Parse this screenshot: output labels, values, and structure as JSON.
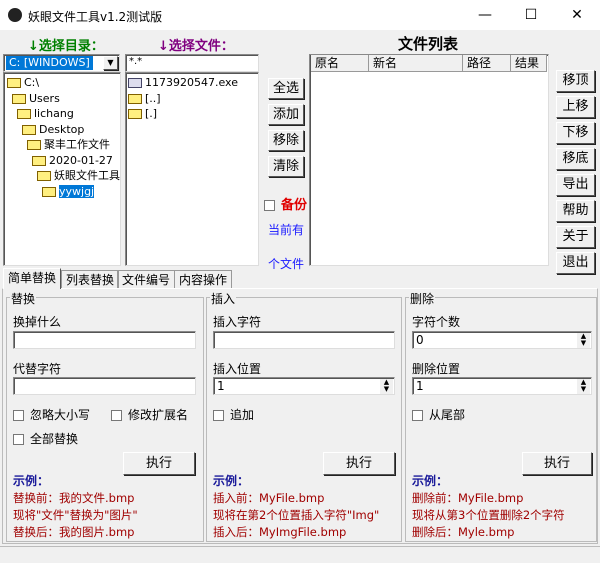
{
  "window": {
    "title": "妖眼文件工具v1.2测试版",
    "minimize": "—",
    "maximize": "☐",
    "close": "✕"
  },
  "left": {
    "dir_label": "↓选择目录：",
    "file_label": "↓选择文件：",
    "drive": "C: [WINDOWS]",
    "filter": "*.*",
    "tree": [
      {
        "label": "C:\\",
        "level": 0
      },
      {
        "label": "Users",
        "level": 1
      },
      {
        "label": "lichang",
        "level": 2
      },
      {
        "label": "Desktop",
        "level": 3
      },
      {
        "label": "聚丰工作文件",
        "level": 4
      },
      {
        "label": "2020-01-27",
        "level": 5
      },
      {
        "label": "妖眼文件工具",
        "level": 6
      },
      {
        "label": "yywjgj",
        "level": 7,
        "selected": true
      }
    ],
    "files": [
      {
        "label": "1173920547.exe",
        "icon": "exe-icon"
      },
      {
        "label": "[..]",
        "icon": "folder-icon"
      },
      {
        "label": "[.]",
        "icon": "folder-icon"
      }
    ]
  },
  "mid": {
    "buttons": [
      "全选",
      "添加",
      "移除",
      "清除"
    ],
    "backup": "备份",
    "current": "当前有",
    "count_suffix": "个文件"
  },
  "list": {
    "title": "文件列表",
    "columns": [
      "原名",
      "新名",
      "路径",
      "结果"
    ]
  },
  "right_buttons": [
    "移顶",
    "上移",
    "下移",
    "移底",
    "导出",
    "帮助",
    "关于",
    "退出"
  ],
  "tabs": [
    "简单替换",
    "列表替换",
    "文件编号",
    "内容操作"
  ],
  "replace": {
    "title": "替换",
    "find_label": "换掉什么",
    "find_value": "",
    "replace_label": "代替字符",
    "replace_value": "",
    "ignore_case": "忽略大小写",
    "modify_ext": "修改扩展名",
    "replace_all": "全部替换",
    "run": "执行",
    "example": "示例：",
    "ex1": "替换前：我的文件.bmp",
    "ex2": "现将\"文件\"替换为\"图片\"",
    "ex3": "替换后：我的图片.bmp"
  },
  "insert": {
    "title": "插入",
    "char_label": "插入字符",
    "char_value": "",
    "pos_label": "插入位置",
    "pos_value": "1",
    "append": "追加",
    "run": "执行",
    "example": "示例：",
    "ex1": "插入前：MyFile.bmp",
    "ex2": "现将在第2个位置插入字符\"Img\"",
    "ex3": "插入后：MyImgFile.bmp"
  },
  "delete": {
    "title": "删除",
    "count_label": "字符个数",
    "count_value": "0",
    "pos_label": "删除位置",
    "pos_value": "1",
    "from_end": "从尾部",
    "run": "执行",
    "example": "示例：",
    "ex1": "删除前：MyFile.bmp",
    "ex2": "现将从第3个位置删除2个字符",
    "ex3": "删除后：Myle.bmp"
  },
  "colors": {
    "dir_label": "#008000",
    "file_label": "#800080",
    "backup": "#e00000",
    "current": "#1a1aff",
    "selection": "#0078d7"
  }
}
